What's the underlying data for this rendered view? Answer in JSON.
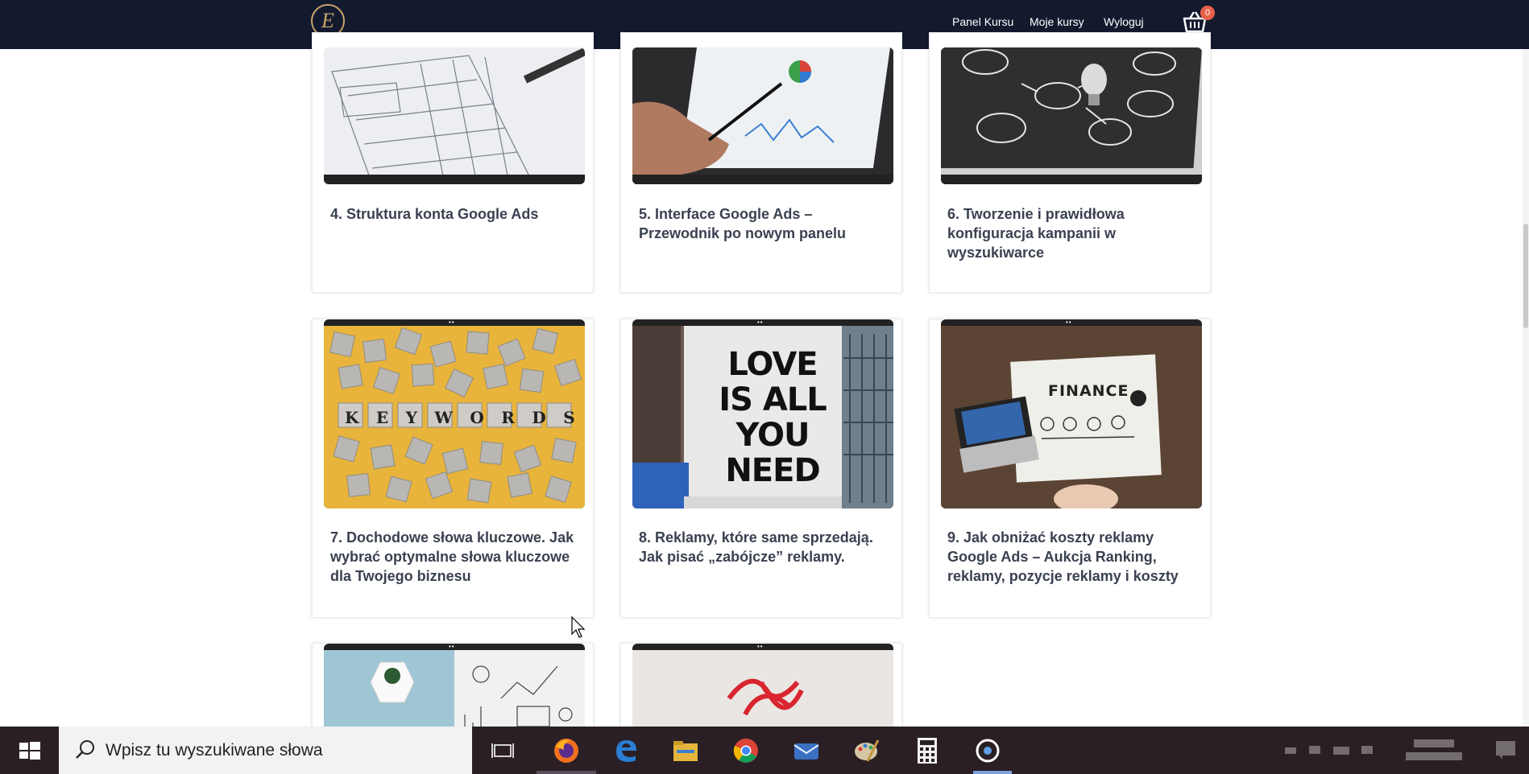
{
  "nav": {
    "logo_letter": "E",
    "links": [
      "Panel Kursu",
      "Moje kursy",
      "Wyloguj"
    ],
    "cart_count": "0"
  },
  "lessons": [
    {
      "title": "4. Struktura konta Google Ads",
      "image": "architectural-blueprint-photo"
    },
    {
      "title": "5. Interface Google Ads – Przewodnik po nowym panelu",
      "image": "tablet-analytics-photo"
    },
    {
      "title": "6. Tworzenie i prawidłowa konfiguracja kampanii w wyszukiwarce",
      "image": "lightbulb-chalkboard-photo"
    },
    {
      "title": "7. Dochodowe słowa kluczowe. Jak wybrać optymalne słowa kluczowe dla Twojego biznesu",
      "image": "keywords-tiles-photo",
      "image_text": "KEYWORDS"
    },
    {
      "title": "8. Reklamy, które same sprzedają. Jak pisać „zabójcze” reklamy.",
      "image": "billboard-photo",
      "image_text": "LOVE IS ALL YOU NEED"
    },
    {
      "title": "9. Jak obniżać koszty reklamy Google Ads – Aukcja Ranking, reklamy, pozycje reklamy i koszty",
      "image": "finance-desk-photo",
      "image_text": "FINANCE"
    },
    {
      "title": "",
      "image": "business-sketch-photo"
    },
    {
      "title": "",
      "image": "red-ribbon-gift-photo"
    }
  ],
  "taskbar": {
    "search_placeholder": "Wpisz tu wyszukiwane słowa",
    "apps": [
      "task-view",
      "firefox",
      "edge",
      "file-explorer",
      "chrome",
      "mail",
      "paint",
      "calculator",
      "cortana"
    ]
  },
  "colors": {
    "nav_bg": "#131a2e",
    "logo_gold": "#c9a36a",
    "title_text": "#3a4150",
    "badge": "#e8604a",
    "taskbar_bg": "#2a1f24"
  }
}
